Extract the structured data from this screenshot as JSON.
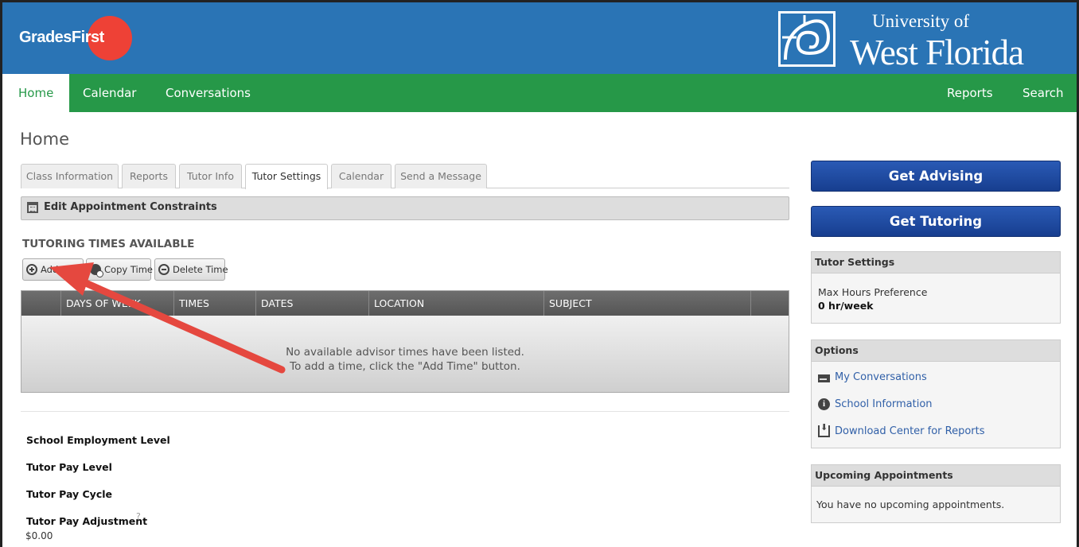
{
  "header": {
    "logo_text": "GradesFirst",
    "university_small": "University of",
    "university_big": "West Florida"
  },
  "nav": {
    "left": [
      "Home",
      "Calendar",
      "Conversations"
    ],
    "right": [
      "Reports",
      "Search"
    ]
  },
  "page": {
    "title": "Home"
  },
  "tabs": [
    "Class Information",
    "Reports",
    "Tutor Info",
    "Tutor Settings",
    "Calendar",
    "Send a Message"
  ],
  "active_tab": "Tutor Settings",
  "constraints_bar": {
    "label": "Edit Appointment Constraints"
  },
  "tutoring": {
    "title": "TUTORING TIMES AVAILABLE",
    "buttons": [
      "Add Time",
      "Copy Time",
      "Delete Time"
    ],
    "columns": [
      "DAYS OF WEEK",
      "TIMES",
      "DATES",
      "LOCATION",
      "SUBJECT"
    ],
    "empty_line1": "No available advisor times have been listed.",
    "empty_line2": "To add a time, click the \"Add Time\" button."
  },
  "fields": {
    "employment": "School Employment Level",
    "pay_level": "Tutor Pay Level",
    "pay_cycle": "Tutor Pay Cycle",
    "pay_adjustment": "Tutor Pay Adjustment",
    "help_mark": "?",
    "pay_adjustment_value": "$0.00"
  },
  "sidebar": {
    "get_advising": "Get Advising",
    "get_tutoring": "Get Tutoring",
    "tutor_settings": {
      "title": "Tutor Settings",
      "label": "Max Hours Preference",
      "value": "0 hr/week"
    },
    "options": {
      "title": "Options",
      "links": [
        "My Conversations",
        "School Information",
        "Download Center for Reports"
      ]
    },
    "upcoming": {
      "title": "Upcoming Appointments",
      "message": "You have no upcoming appointments."
    }
  },
  "colors": {
    "header_blue": "#2a74b5",
    "nav_green": "#269848",
    "logo_red": "#ee4136",
    "button_blue": "#1f4ea3",
    "link_blue": "#3160a8",
    "arrow_red": "#e5483f"
  }
}
